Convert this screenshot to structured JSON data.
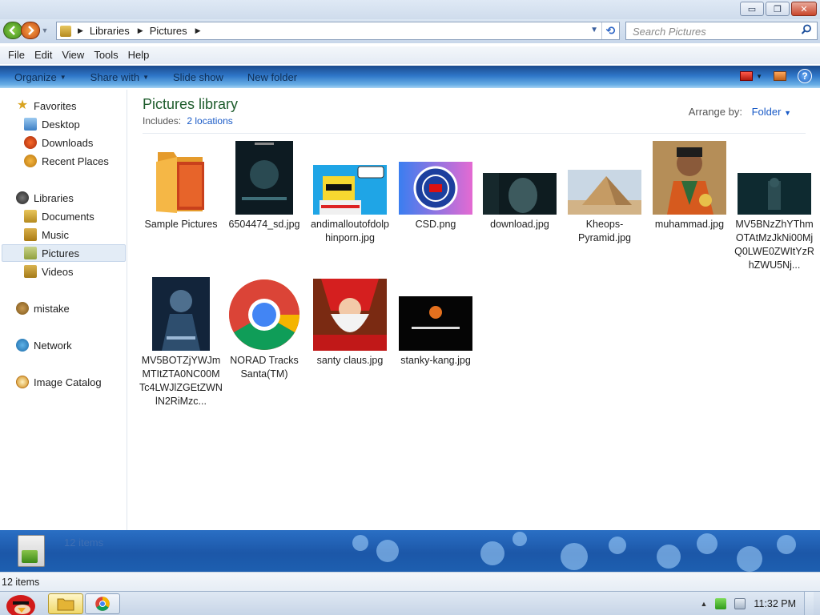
{
  "window": {
    "min_glyph": "▭",
    "max_glyph": "❐",
    "close_glyph": "✕"
  },
  "address": {
    "crumbs": [
      "Libraries",
      "Pictures"
    ],
    "search_placeholder": "Search Pictures"
  },
  "menu": [
    "File",
    "Edit",
    "View",
    "Tools",
    "Help"
  ],
  "toolbar": {
    "organize": "Organize",
    "share_with": "Share with",
    "slide_show": "Slide show",
    "new_folder": "New folder",
    "help_glyph": "?"
  },
  "nav": {
    "favorites": "Favorites",
    "desktop": "Desktop",
    "downloads": "Downloads",
    "recent_places": "Recent Places",
    "libraries": "Libraries",
    "documents": "Documents",
    "music": "Music",
    "pictures": "Pictures",
    "videos": "Videos",
    "user": "mistake",
    "network": "Network",
    "image_catalog": "Image Catalog"
  },
  "library": {
    "title": "Pictures library",
    "includes_label": "Includes:",
    "includes_link": "2 locations",
    "arrange_label": "Arrange by:",
    "arrange_value": "Folder"
  },
  "files": [
    "Sample Pictures",
    "6504474_sd.jpg",
    "andimalloutofdolphinporn.jpg",
    "CSD.png",
    "download.jpg",
    "Kheops-Pyramid.jpg",
    "muhammad.jpg",
    "MV5BNzZhYThmOTAtMzJkNi00MjQ0LWE0ZWItYzRhZWU5Nj...",
    "MV5BOTZjYWJmMTItZTA0NC00MTc4LWJlZGEtZWNlN2RiMzc...",
    "NORAD Tracks Santa(TM)",
    "santy claus.jpg",
    "stanky-kang.jpg"
  ],
  "details": {
    "count": "12 items"
  },
  "status": {
    "count": "12 items"
  },
  "taskbar": {
    "time": "11:32 PM"
  },
  "colors": {
    "accent": "#1a5bc7",
    "title_green": "#1e5c2c",
    "toolbar_blue": "#2e76c8"
  }
}
